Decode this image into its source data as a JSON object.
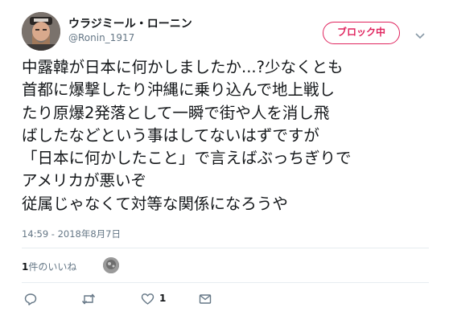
{
  "user": {
    "display_name": "ウラジミール・ローニン",
    "handle": "@Ronin_1917"
  },
  "block_button_label": "ブロック中",
  "tweet": {
    "lines": [
      "中露韓が日本に何かしましたか...?少なくとも",
      "首都に爆撃したり沖縄に乗り込んで地上戦し",
      "たり原爆2発落として一瞬で街や人を消し飛",
      "ばしたなどという事はしてないはずですが",
      "「日本に何かしたこと」で言えばぶっちぎりで",
      "アメリカが悪いぞ",
      "従属じゃなくて対等な関係になろうや"
    ],
    "timestamp": "14:59 - 2018年8月7日"
  },
  "likes": {
    "count": "1",
    "label_suffix": "件のいいね"
  },
  "actions": {
    "reply_icon": "reply-icon",
    "retweet_icon": "retweet-icon",
    "like_icon": "heart-icon",
    "like_count": "1",
    "dm_icon": "envelope-icon"
  },
  "colors": {
    "block_accent": "#e0245e",
    "secondary_text": "#657786",
    "divider": "#e6ecf0"
  }
}
